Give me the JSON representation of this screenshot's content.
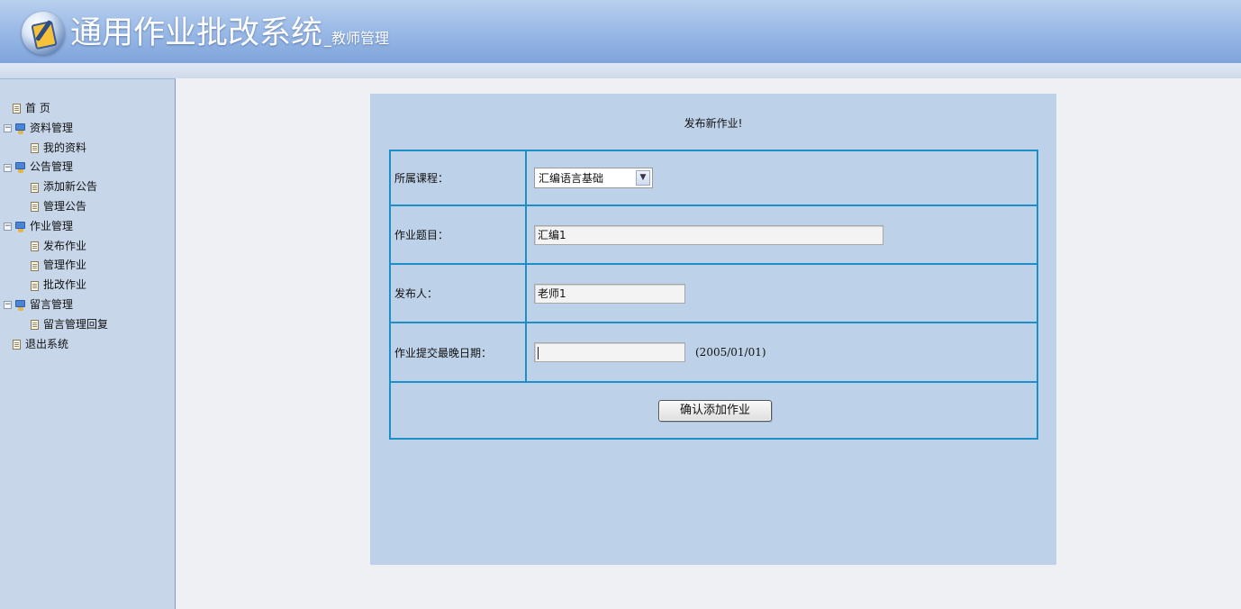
{
  "header": {
    "title": "通用作业批改系统",
    "subtitle": "_教师管理"
  },
  "sidebar": {
    "items": [
      {
        "label": "首  页",
        "level": 0,
        "icon": "doc-icon"
      },
      {
        "label": "资料管理",
        "level": 0,
        "icon": "computer-icon",
        "toggle": "⊟"
      },
      {
        "label": "我的资料",
        "level": 1,
        "icon": "doc-icon"
      },
      {
        "label": "公告管理",
        "level": 0,
        "icon": "computer-icon",
        "toggle": "⊟"
      },
      {
        "label": "添加新公告",
        "level": 1,
        "icon": "doc-icon"
      },
      {
        "label": "管理公告",
        "level": 1,
        "icon": "doc-icon"
      },
      {
        "label": "作业管理",
        "level": 0,
        "icon": "computer-icon",
        "toggle": "⊟"
      },
      {
        "label": "发布作业",
        "level": 1,
        "icon": "doc-icon"
      },
      {
        "label": "管理作业",
        "level": 1,
        "icon": "doc-icon"
      },
      {
        "label": "批改作业",
        "level": 1,
        "icon": "doc-icon"
      },
      {
        "label": "留言管理",
        "level": 0,
        "icon": "computer-icon",
        "toggle": "⊟"
      },
      {
        "label": "留言管理回复",
        "level": 1,
        "icon": "doc-icon"
      },
      {
        "label": "退出系统",
        "level": 0,
        "icon": "doc-icon"
      }
    ]
  },
  "form": {
    "title": "发布新作业!",
    "course_label": "所属课程：",
    "course_value": "汇编语言基础",
    "topic_label": "作业题目：",
    "topic_value": "汇编1",
    "publisher_label": "发布人：",
    "publisher_value": "老师1",
    "deadline_label": "作业提交最晚日期：",
    "deadline_value": "",
    "deadline_hint": "(2005/01/01)",
    "submit_label": "确认添加作业"
  }
}
